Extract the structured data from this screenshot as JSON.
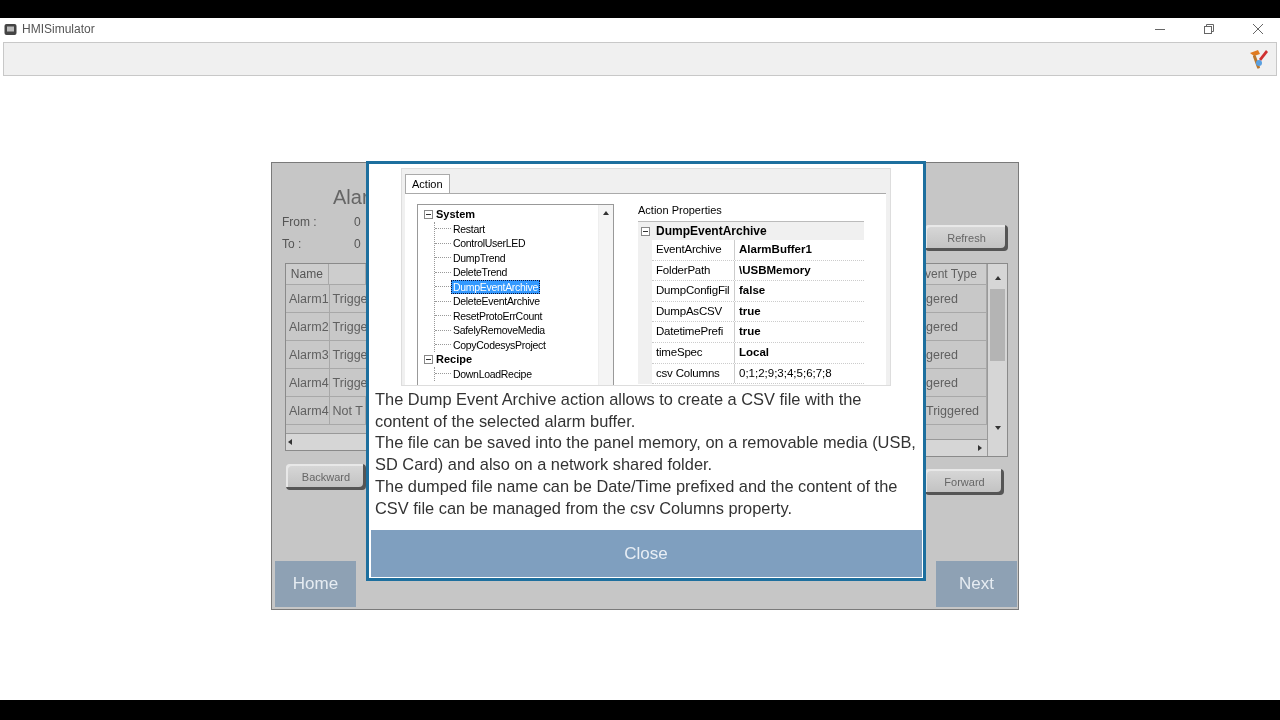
{
  "window": {
    "title": "HMISimulator"
  },
  "screen": {
    "title": "Alar",
    "from_label": "From :",
    "from_value": "0",
    "to_label": "To :",
    "to_value": "0",
    "left_table": {
      "header": "Name",
      "rows": [
        {
          "name": "Alarm1",
          "state": "Trigge"
        },
        {
          "name": "Alarm2",
          "state": "Trigge"
        },
        {
          "name": "Alarm3",
          "state": "Trigge"
        },
        {
          "name": "Alarm4",
          "state": "Trigge"
        },
        {
          "name": "Alarm4",
          "state": "Not T"
        }
      ]
    },
    "right_table": {
      "header": "vent Type",
      "rows": [
        "gered",
        "gered",
        "gered",
        "gered",
        "Triggered"
      ]
    },
    "backward_button": "Backward",
    "refresh_button": "Refresh",
    "forward_button": "Forward",
    "home_button": "Home",
    "next_button": "Next"
  },
  "dialog": {
    "tab": {
      "label": "Action",
      "selected": true
    },
    "tree": [
      {
        "label": "System",
        "expanded": true,
        "children": [
          {
            "label": "Restart",
            "selected": false
          },
          {
            "label": "ControlUserLED",
            "selected": false
          },
          {
            "label": "DumpTrend",
            "selected": false
          },
          {
            "label": "DeleteTrend",
            "selected": false
          },
          {
            "label": "DumpEventArchive",
            "selected": true
          },
          {
            "label": "DeleteEventArchive",
            "selected": false
          },
          {
            "label": "ResetProtoErrCount",
            "selected": false
          },
          {
            "label": "SafelyRemoveMedia",
            "selected": false
          },
          {
            "label": "CopyCodesysProject",
            "selected": false
          }
        ]
      },
      {
        "label": "Recipe",
        "expanded": true,
        "children": [
          {
            "label": "DownLoadRecipe",
            "selected": false
          }
        ]
      }
    ],
    "properties_label": "Action Properties",
    "object": {
      "label": "DumpEventArchive",
      "expanded": true
    },
    "properties": [
      {
        "name": "EventArchive",
        "value": "AlarmBuffer1",
        "bold": true
      },
      {
        "name": "FolderPath",
        "value": "\\USBMemory",
        "bold": true
      },
      {
        "name": "DumpConfigFil",
        "value": "false",
        "bold": true
      },
      {
        "name": "DumpAsCSV",
        "value": "true",
        "bold": true
      },
      {
        "name": "DatetimePrefi",
        "value": "true",
        "bold": true
      },
      {
        "name": "timeSpec",
        "value": "Local",
        "bold": true
      },
      {
        "name": "csv Columns",
        "value": "0;1;2;9;3;4;5;6;7;8",
        "bold": false
      }
    ],
    "description": [
      "The Dump Event Archive action allows to create a CSV file with the content of the selected alarm buffer.",
      "The file can be saved into the panel memory, on a removable media (USB, SD Card) and also on a network shared folder.",
      "The dumped file name can be Date/Time prefixed and the content of the CSV file can be managed from the csv Columns property."
    ],
    "close_button": "Close"
  }
}
